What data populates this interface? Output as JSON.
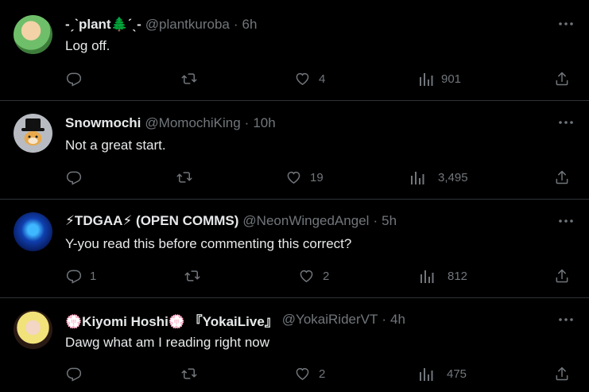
{
  "colors": {
    "background": "#000000",
    "text": "#e7e9ea",
    "muted": "#71767b",
    "divider": "#2f3336"
  },
  "tweets": [
    {
      "name": "-ˏˋplant🌲ˊˎ-",
      "handle": "@plantkuroba",
      "dot": "·",
      "time": "6h",
      "text": "Log off.",
      "replies": "",
      "retweets": "",
      "likes": "4",
      "views": "901"
    },
    {
      "name": "Snowmochi",
      "handle": "@MomochiKing",
      "dot": "·",
      "time": "10h",
      "text": "Not a great start.",
      "replies": "",
      "retweets": "",
      "likes": "19",
      "views": "3,495"
    },
    {
      "name": "⚡TDGAA⚡ (OPEN COMMS)",
      "handle": "@NeonWingedAngel",
      "dot": "·",
      "time": "5h",
      "text": "Y-you read this before commenting this correct?",
      "replies": "1",
      "retweets": "",
      "likes": "2",
      "views": "812"
    },
    {
      "name": "💮Kiyomi Hoshi💮 『YokaiLive』",
      "handle": "@YokaiRiderVT",
      "dot": "·",
      "time": "4h",
      "text": "Dawg what am I reading right now",
      "replies": "",
      "retweets": "",
      "likes": "2",
      "views": "475"
    }
  ]
}
